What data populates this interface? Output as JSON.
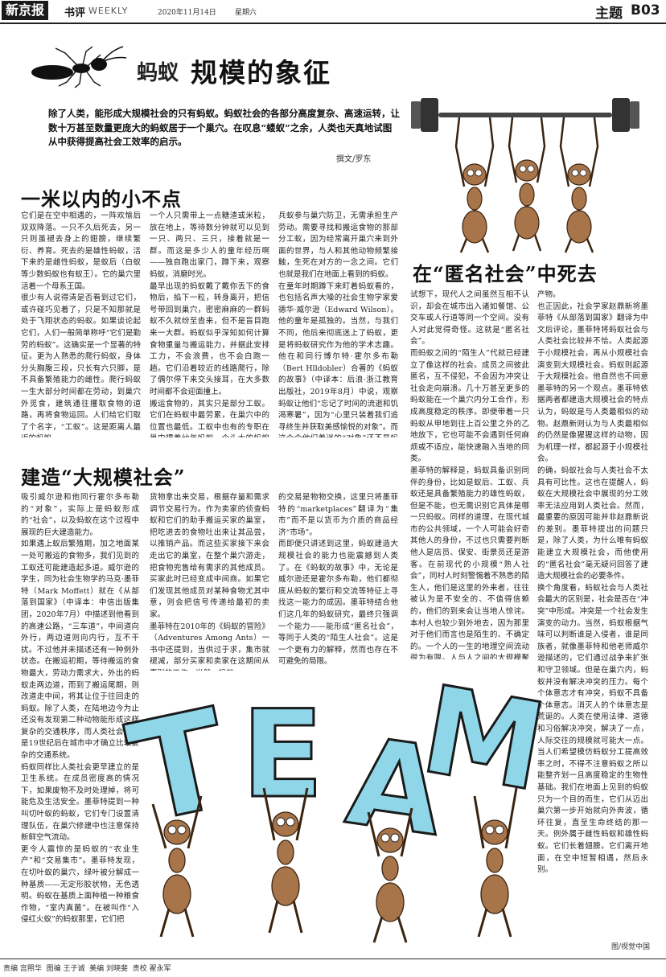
{
  "masthead": {
    "paper": "新京报",
    "section_cn": "书评",
    "section_en": "WEEKLY",
    "date": "2020年11月14日",
    "weekday": "星期六",
    "topic": "主题",
    "page": "B03"
  },
  "article": {
    "kicker": "蚂蚁",
    "headline": "规模的象征",
    "lead": "除了人类，能形成大规模社会的只有蚂蚁。蚂蚁社会的各部分高度复杂、高速运转，让数十万甚至数量更庞大的蚂蚁居于一个巢穴。在叹息“蝼蚁”之余，人类也天真地试图从中获得提高社会工效率的启示。",
    "byline": "撰文/罗东"
  },
  "sections": {
    "s1": {
      "title": "一米以内的小不点",
      "col1": "它们是在空中相遇的，一阵欢愉后双双降落。一只不久后死去，另一只则虽褪去身上的翅膀，继续繁衍、养育。死去的是雄性蚂蚁，活下来的是雌性蚂蚁，是蚁后（白蚁等少数蚂蚁也有蚁王）。它的巢穴里活着一个母系王国。\n很少有人说得清是否看到过它们，或许碰巧见着了，只是不知那就是处于飞翔状态的蚂蚁。如果谈论起它们，人们一般简单称呼“它们是勤劳的蚂蚁”。这确实是一个显著的特征。更为人熟悉的爬行蚂蚁，身体分头胸腹三段，只长有六只脚，是不具备繁殖能力的雌性。爬行蚂蚁一生大部分时间都在劳动，到巢穴外觅食，建筑通往攫取食物的道路，再将食物运回。人们给它们取了个名字，“工蚁”。这是距离人最近的蚂蚁。",
      "col2": "一个人只需带上一点糖渣或米粒，放在地上，等待数分钟就可以见到一只、两只、三只，接着就是一群。而这是多少人的童年经历啊——独自跑出家门，蹲下来，观察蚂蚁，消磨时光。\n最早出现的蚂蚁戴了戴你丢下的食物后，掐下一粒，转身离开，把信号带回到巢穴，密密麻麻的一群蚂蚁不久就纷至沓来，但不是盲目跑来一大群。蚂蚁似乎深知如何计算食物重量与搬运能力，并据此安排工力，不会浪费，也不会白跑一趟。它们沿着较近的线路爬行，除了偶尔停下来交头接耳，在大多数时间都不会迎面撞上。\n搬运食物的，其实只是部分工蚁。它们在蚂蚁中最劳累，在巢穴中的位置也最低。工蚁中也有的专职在巢内喂养幼年蚂蚁。个头大的蚂蚁则可能作为",
      "col3": "兵蚁参与巢穴防卫，无需承担生产劳动。需要寻找和搬运食物的那部分工蚁，因为经常离开巢穴来到外面的世界，与人和其他动物频繁接触，生死在对方的一念之间。它们也就是我们在地面上看到的蚂蚁。\n在童年时期蹲下来盯着蚂蚁看的，也包括名声大噪的社会生物学家爱德华·威尔逊（Edward Wilson）。他的童年是孤独的。当然，与我们不同，他后来彻底迷上了蚂蚁，更是将蚂蚁研究作为他的学术志趣。他在和同行博尔特·霍尔多布勒（Bert Hlldobler）合著的《蚂蚁的故事》（中译本：后浪·浙江教育出版社，2019年8月）中说，观察蚂蚁让他们“忘记了时间的流逝和饥渴寒暑”，因为“心里只装着我们追寻终生并获取美感愉悦的对象”。而这个令他们着迷的“对象”还不是蚂蚁。"
    },
    "s2": {
      "title": "建造“大规模社会”",
      "col1": "吸引威尔逊和他同行霍尔多布勒的“对象”，实际上是蚂蚁形成的“社会”，以及蚂蚁在这个过程中展现的巨大建造能力。\n如果遇上蚁后繁殖期，加之地面某一处可搬运的食物多，我们见到的工蚁还可能建造起多道。威尔逊的学生，同为社会生物学的马克·墨菲特（Mark Moffett）就在《从部落到国家》（中译本：中信出版集团，2020年7月）中描述到他看到的高速公路，“三车道”，中间道向外行，两边道则向内行，互不干扰。不过他并未描述还有一种例外状态。在搬运初期，等待搬运的食物最大，劳动力需求大，外出的蚂蚁走两边道，而到了搬运尾期，则改道走中间，将其让位于往回走的蚂蚁。除了人类，在陆地边今为止还没有发现第二种动物能形成这样复杂的交通秩序，而人类社会也只是19世纪后在城市中才确立比较复杂的交通系统。\n蚂蚁同样比人类社会更早建立的是卫生系统。在成员密度高的情况下，如果废物不及时处理掉，将可能危及生活安全。墨菲特提到一种叫切叶蚁的蚂蚁，它们专门设置清理队伍，在巢穴修建中也注意保持新鲜空气流动。\n更令人震惊的是蚂蚁的“农业生产”和“交易集市”。墨菲特发现，在切叶蚁的巢穴，绿叶被分解成一种基质——无定形胶状物，无色透明。蚂蚁在基质上面种植一种粮食作物，“室内真菌”。在被叫作“入侵红火蚁”的蚂蚁那里，它们把",
      "col2": "货物拿出来交易，根据存量和需求调节交易行为。作为卖家的侦查蚂蚁和它们的助手搬运买家的巢室，把吃进去的食物吐出来让其品尝，以推销产品。而这些买家接下来会走出它的巢室，在整个巢穴游走，把食物兜售给有需求的其他成员。买家此时已经变成中间商。如果它们发现其他成员对某种食物尤其中意，则会把信号传递给最初的卖家。\n墨菲特在2010年的《蚂蚁的冒险》（Adventures Among Ants）一书中还提到，当供过于求，集市就褪减，部分买家和卖家在这期间从事别的工作。当然，蚂蚁",
      "col3": "的交易是物物交换，这里只将墨菲特的“marketplaces”翻译为“集市”而不是以货币为介质的商品经济“市场”。\n而即便只讲述到这里，蚂蚁建造大规模社会的能力也能震撼到人类了。在《蚂蚁的故事》中，无论是威尔逊还是霍尔多布勒，他们都彻底从蚂蚁的繁衍和交流等特征上寻找这一能力的成因。墨菲特结合他们这几年的蚂蚁研究，最终只强调一个能力——能形成“匿名社会”，等同于人类的“陌生人社会”。这是一个更有力的解释，然而也存在不可避免的局限。"
    },
    "s3": {
      "title": "在“匿名社会”中死去",
      "col1": "试想下，现代人之间虽然互相不认识，却会在城市出入诸如餐馆、公交车或人行道等同一个空间。没有人对此觉得奇怪。这就是“匿名社会”。\n而蚂蚁之间的“陌生人”代就已经建立了像这样的社会。成员之间彼此匿名，互不侵犯，不会因为冲突让社会走向崩溃。几十万甚至更多的蚂蚁能在一个巢穴内分工合作，形成高度稳定的秩序。即便带着一只蚂蚁从甲地到往上百公里之外的乙地放下，它也可能不会遇到任何麻烦或不适应，能快速融入当地的同类。\n墨菲特的解释是，蚂蚁具备识别同伴的身份，比如是蚁后、工蚁、兵蚁还是具备繁殖能力的雄性蚂蚁，但是不能，也无需识别它具体是哪一只蚂蚁。同样的道理，在现代城市的公共领域，一个人可能会好奇其他人的身份，不过也只需要判断他人是店员、保安、街景员还是游客。在前现代的小规模“熟人社会”，同村人时刻警惕着不熟悉的陌生人，他们是这里的外来者，往往被认为是不安全的、不值得信赖的，他们的到来会让当地人惊诧。本村人也较少到外地去，因为那里对于他们而言也是陌生的、不确定的。一个人的一生的地理空间流动很为有限。人与人之间的大规模聚集则是现代社会的",
      "col2": "产物。\n也正因此，社会学家赵鼎新将墨菲特《从部落到国家》翻译为中文后评论，墨菲特将蚂蚁社会与人类社会比较并不恰。人类起源于小规模社会，再从小规模社会演变到大规模社会。蚂蚁则起源于大规模社会。他自然也不同意墨菲特的另一个观点。墨菲特依据两者都建造大规模社会的特点认为，蚂蚁是与人类最相似的动物。赵鼎新则认为与人类最相似的仍然是像猩猩这样的动物，因为机理一样，都起源于小规模社会。\n的确，蚂蚁社会与人类社会不太具有可比性。这也在提醒人，蚂蚁在大规模社会中展现的分工效率无法应用到人类社会。然而，最重要的原因可能并非赵鼎新说的差别。墨菲特提出的问题只是，除了人类，为什么唯有蚂蚁能建立大规模社会，而他使用的“匿名社会”毫无疑问回答了建造大规模社会的必要条件。\n换个角度看，蚂蚁社会与人类社会最大的区别是，社会是否在“冲突”中形成。冲突是一个社会发生演变的动力。当然，蚂蚁根据气味可以判断谁是入侵者，谁是同族者，就像墨菲特和他老师威尔逊描述的，它们通过战争来扩张和守卫领域。但是在巢穴内，蚂蚁并没有解决冲突的压力。每个个体意志才有冲突，蚂蚁不具备个体意志。消灭人的个体意志是荒诞的。人类在使用法律、道德和习俗解决冲突，解决了一点，人际交往的规模就可能大一点。当人们希望模仿蚂蚁分工提高效率之时，不得不注意蚂蚁之所以能整齐划一且高度稳定的生物性基础。我们在地面上见到的蚂蚁只为一个目的而生，它们从迈出巢穴第一步开始就向外奔波，循环往复，直至生命终结的那一天。例外属于雌性蚂蚁和雄性蚂蚁。它们长着翅膀。它们离开地面，在空中短暂相遇，然后永别。"
    }
  },
  "credits": {
    "illustration": "图/视觉中国",
    "footer": "责编 宫照华  图编 王子诚  美编 刘晓斐  责校 翟永军"
  },
  "illustration_text": [
    "T",
    "E",
    "A",
    "M"
  ]
}
